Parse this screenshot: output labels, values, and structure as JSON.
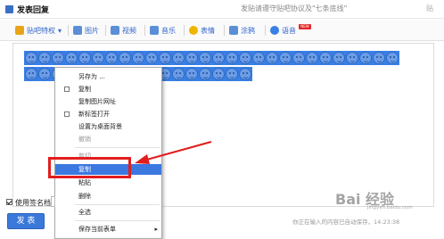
{
  "header": {
    "title": "发表回复",
    "notice": "发贴请遵守贴吧协议及\"七条底线\"",
    "edge_text": "贴"
  },
  "toolbar": {
    "items": [
      {
        "label": "贴吧特权",
        "icon": "crown-icon",
        "color": "#e8a317"
      },
      {
        "label": "图片",
        "icon": "image-icon",
        "color": "#5a8fd8"
      },
      {
        "label": "视频",
        "icon": "video-icon",
        "color": "#5a8fd8"
      },
      {
        "label": "音乐",
        "icon": "music-icon",
        "color": "#5a8fd8"
      },
      {
        "label": "表情",
        "icon": "smiley-icon",
        "color": "#f0b400"
      },
      {
        "label": "涂鸦",
        "icon": "graffiti-icon",
        "color": "#5a8fd8"
      },
      {
        "label": "语音",
        "icon": "microphone-icon",
        "color": "#3a7fe6"
      }
    ],
    "new_badge": "NEW"
  },
  "context_menu": {
    "items": [
      {
        "label": "另存为 ...",
        "disabled": false
      },
      {
        "label": "复制",
        "disabled": false
      },
      {
        "label": "复制图片网址",
        "disabled": false
      },
      {
        "label": "新标签打开",
        "disabled": false
      },
      {
        "label": "设置为桌面背景",
        "disabled": false
      },
      {
        "label": "撤销",
        "disabled": true
      },
      {
        "label": "剪切",
        "disabled": true
      },
      {
        "label": "复制",
        "disabled": false,
        "highlighted": true
      },
      {
        "label": "粘贴",
        "disabled": false
      },
      {
        "label": "删除",
        "disabled": false
      },
      {
        "label": "全选",
        "disabled": false
      },
      {
        "label": "保存当前表单",
        "disabled": false,
        "submenu": true
      }
    ]
  },
  "bottom": {
    "signature_label": "使用签名档",
    "signature_checked": true,
    "post_button": "发 表",
    "status_text": "你正在输入的内容已自动保存，14:23:38"
  },
  "watermark": {
    "text": "Bai 经验",
    "sub": "jingyan.baidu.com"
  },
  "colors": {
    "accent": "#3a78d9",
    "selection": "#3a7fe6",
    "highlight_box": "#e21d1d"
  }
}
